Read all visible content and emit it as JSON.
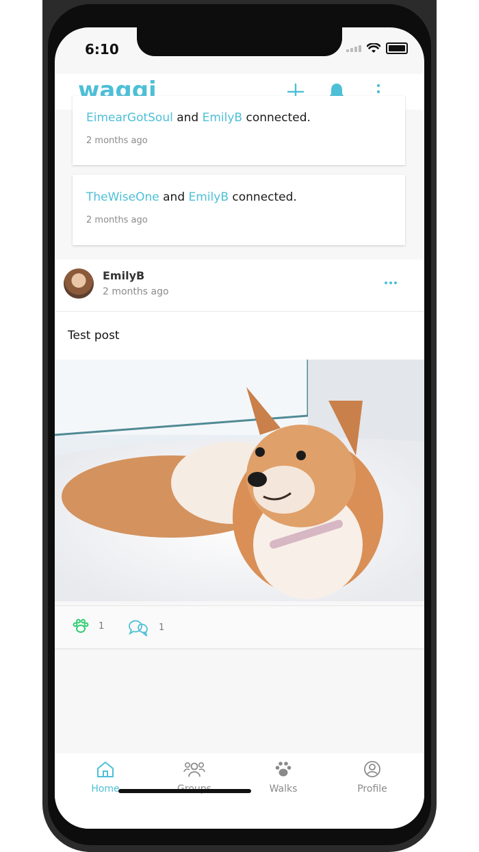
{
  "status": {
    "time": "6:10"
  },
  "app": {
    "logo": "waggi",
    "accent": "#4dbfd6"
  },
  "notifications": [
    {
      "user_a": "EimearGotSoul",
      "conj": "and",
      "user_b": "EmilyB",
      "action": "connected.",
      "time": "2 months ago"
    },
    {
      "user_a": "TheWiseOne",
      "conj": "and",
      "user_b": "EmilyB",
      "action": "connected.",
      "time": "2 months ago"
    }
  ],
  "post": {
    "author": "EmilyB",
    "time": "2 months ago",
    "text": "Test post",
    "likes": "1",
    "comments": "1"
  },
  "tabs": [
    {
      "label": "Home",
      "icon": "home-icon"
    },
    {
      "label": "Groups",
      "icon": "groups-icon"
    },
    {
      "label": "Walks",
      "icon": "paw-icon"
    },
    {
      "label": "Profile",
      "icon": "profile-icon"
    }
  ]
}
